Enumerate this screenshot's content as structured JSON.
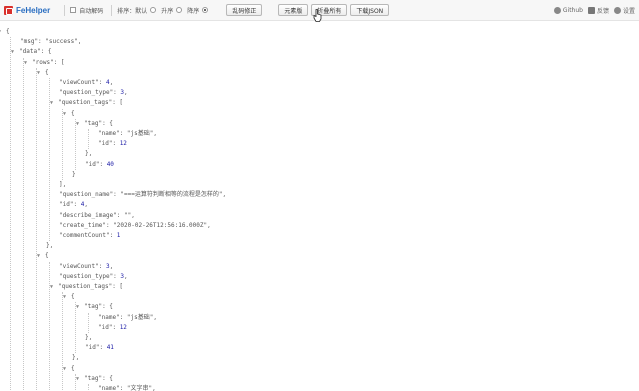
{
  "toolbar": {
    "brand": "FeHelper",
    "auto_decode": "自动解码",
    "sort_label": "排序：",
    "sort_default": "默认",
    "sort_asc": "升序",
    "sort_desc": "降序",
    "btn_fix": "乱码修正",
    "btn_elements": "元素版",
    "btn_fold_all": "折叠所有",
    "btn_download": "下载JSON",
    "link_github": "Github",
    "link_feedback": "反馈",
    "link_settings": "设置"
  },
  "json_lines": [
    {
      "text": "{",
      "toggle": true,
      "indent": 0
    },
    {
      "text": "\"msg\":  \"success\",",
      "indent": 1
    },
    {
      "text": "\"data\":  {",
      "toggle": true,
      "indent": 1
    },
    {
      "text": "\"rows\":  [",
      "toggle": true,
      "indent": 2
    },
    {
      "text": "{",
      "toggle": true,
      "indent": 3
    },
    {
      "text": "\"viewCount\":  ",
      "num": "4",
      "suffix": ",",
      "indent": 4
    },
    {
      "text": "\"question_type\":  ",
      "num": "3",
      "suffix": ",",
      "indent": 4
    },
    {
      "text": "\"question_tags\":  [",
      "toggle": true,
      "indent": 4
    },
    {
      "text": "{",
      "toggle": true,
      "indent": 5
    },
    {
      "text": "\"tag\":  {",
      "toggle": true,
      "indent": 6
    },
    {
      "text": "\"name\":  \"js基础\",",
      "indent": 7
    },
    {
      "text": "\"id\":  ",
      "num": "12",
      "indent": 7
    },
    {
      "text": "},",
      "indent": 6
    },
    {
      "text": "\"id\":  ",
      "num": "40",
      "indent": 6
    },
    {
      "text": "}",
      "indent": 5
    },
    {
      "text": "],",
      "indent": 4
    },
    {
      "text": "\"question_name\":  \"===运算符判断相等的流程是怎样的\",",
      "indent": 4
    },
    {
      "text": "\"id\":  ",
      "num": "4",
      "suffix": ",",
      "indent": 4
    },
    {
      "text": "\"describe_image\":  \"\",",
      "indent": 4
    },
    {
      "text": "\"create_time\":  \"2020-02-26T12:56:16.000Z\",",
      "indent": 4
    },
    {
      "text": "\"commentCount\":  ",
      "num": "1",
      "indent": 4
    },
    {
      "text": "},",
      "indent": 3
    },
    {
      "text": "{",
      "toggle": true,
      "indent": 3
    },
    {
      "text": "\"viewCount\":  ",
      "num": "3",
      "suffix": ",",
      "indent": 4
    },
    {
      "text": "\"question_type\":  ",
      "num": "3",
      "suffix": ",",
      "indent": 4
    },
    {
      "text": "\"question_tags\":  [",
      "toggle": true,
      "indent": 4
    },
    {
      "text": "{",
      "toggle": true,
      "indent": 5
    },
    {
      "text": "\"tag\":  {",
      "toggle": true,
      "indent": 6
    },
    {
      "text": "\"name\":  \"js基础\",",
      "indent": 7
    },
    {
      "text": "\"id\":  ",
      "num": "12",
      "indent": 7
    },
    {
      "text": "},",
      "indent": 6
    },
    {
      "text": "\"id\":  ",
      "num": "41",
      "indent": 6
    },
    {
      "text": "},",
      "indent": 5
    },
    {
      "text": "{",
      "toggle": true,
      "indent": 5
    },
    {
      "text": "\"tag\":  {",
      "toggle": true,
      "indent": 6
    },
    {
      "text": "\"name\":  \"文字串\",",
      "indent": 7
    }
  ],
  "colors": {
    "number": "#1a1aa6",
    "brand": "#2a6ec1",
    "logo": "#d9302c"
  }
}
